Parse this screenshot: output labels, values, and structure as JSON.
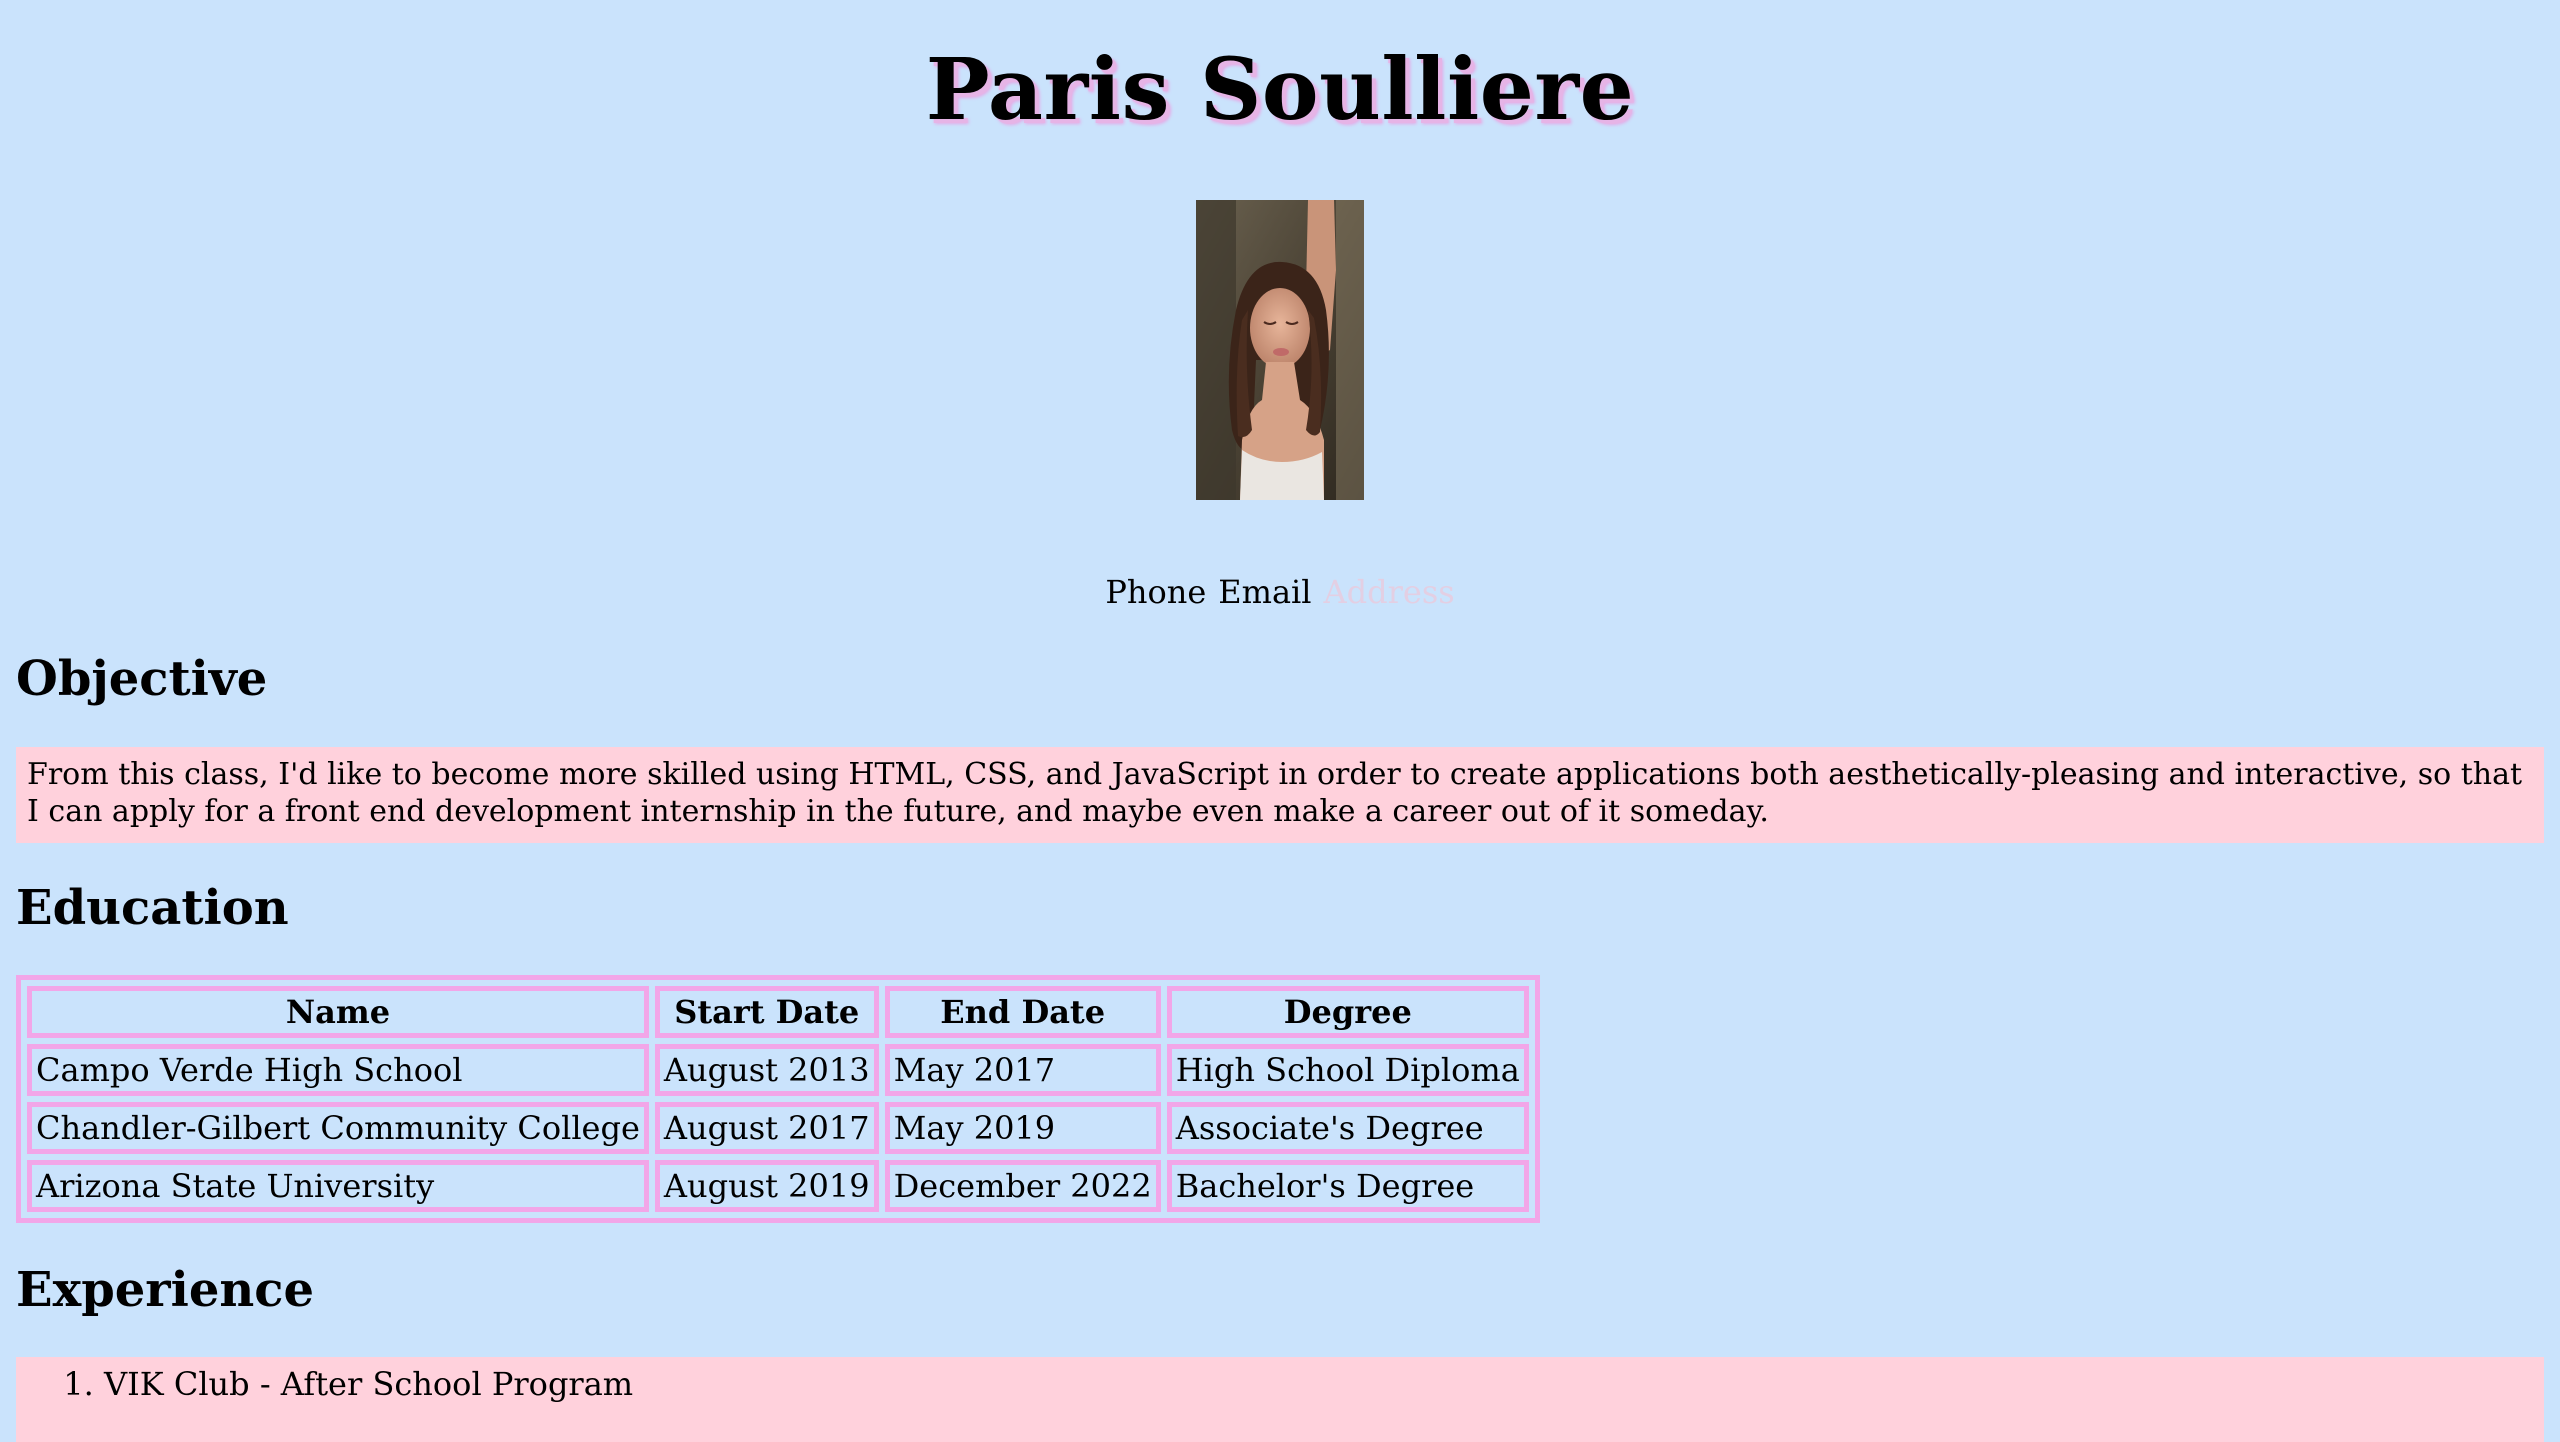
{
  "header": {
    "name": "Paris Soulliere"
  },
  "contact": {
    "phone": "Phone",
    "email": "Email",
    "address": "Address"
  },
  "objective": {
    "heading": "Objective",
    "text": "From this class, I'd like to become more skilled using HTML, CSS, and JavaScript in order to create applications both aesthetically-pleasing and interactive, so that I can apply for a front end development internship in the future, and maybe even make a career out of it someday."
  },
  "education": {
    "heading": "Education",
    "columns": [
      "Name",
      "Start Date",
      "End Date",
      "Degree"
    ],
    "rows": [
      [
        "Campo Verde High School",
        "August 2013",
        "May 2017",
        "High School Diploma"
      ],
      [
        "Chandler-Gilbert Community College",
        "August 2017",
        "May 2019",
        "Associate's Degree"
      ],
      [
        "Arizona State University",
        "August 2019",
        "December 2022",
        "Bachelor's Degree"
      ]
    ]
  },
  "experience": {
    "heading": "Experience",
    "items": [
      "VIK Club - After School Program"
    ]
  },
  "colors": {
    "background": "#cae3fc",
    "box_background": "#ffd1dc",
    "table_border": "#f2a6e8",
    "title_shadow": "#e6b4e6",
    "address_link": "#e3cfe3"
  }
}
